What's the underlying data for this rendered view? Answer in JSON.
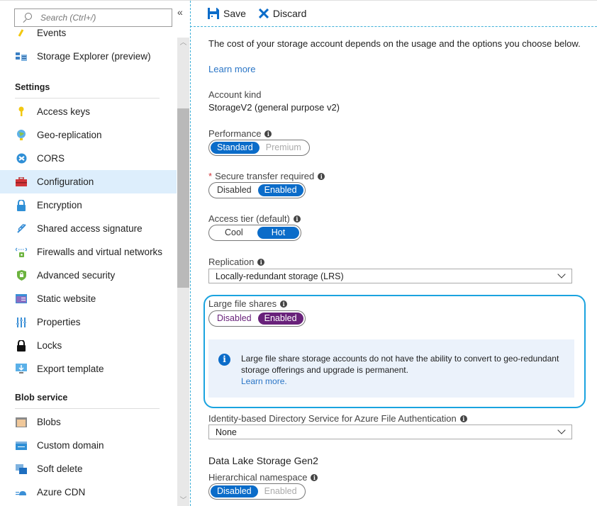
{
  "sidebar": {
    "search_placeholder": "Search (Ctrl+/)",
    "collapse_icon": "double-chevron-left",
    "items_top": [
      {
        "label": "Events",
        "icon": "lightning-icon"
      },
      {
        "label": "Storage Explorer (preview)",
        "icon": "storage-explorer-icon"
      }
    ],
    "settings_header": "Settings",
    "settings_items": [
      {
        "label": "Access keys",
        "icon": "key-icon"
      },
      {
        "label": "Geo-replication",
        "icon": "globe-icon"
      },
      {
        "label": "CORS",
        "icon": "cors-icon"
      },
      {
        "label": "Configuration",
        "icon": "toolbox-icon",
        "active": true
      },
      {
        "label": "Encryption",
        "icon": "lock-icon"
      },
      {
        "label": "Shared access signature",
        "icon": "link-icon"
      },
      {
        "label": "Firewalls and virtual networks",
        "icon": "firewall-icon"
      },
      {
        "label": "Advanced security",
        "icon": "shield-icon"
      },
      {
        "label": "Static website",
        "icon": "website-icon"
      },
      {
        "label": "Properties",
        "icon": "properties-icon"
      },
      {
        "label": "Locks",
        "icon": "padlock-icon"
      },
      {
        "label": "Export template",
        "icon": "export-icon"
      }
    ],
    "blob_header": "Blob service",
    "blob_items": [
      {
        "label": "Blobs",
        "icon": "blobs-icon"
      },
      {
        "label": "Custom domain",
        "icon": "www-icon"
      },
      {
        "label": "Soft delete",
        "icon": "soft-delete-icon"
      },
      {
        "label": "Azure CDN",
        "icon": "cdn-icon"
      }
    ]
  },
  "toolbar": {
    "save_label": "Save",
    "discard_label": "Discard"
  },
  "main": {
    "intro_text": "The cost of your storage account depends on the usage and the options you choose below.",
    "learn_more": "Learn more",
    "account_kind_label": "Account kind",
    "account_kind_value": "StorageV2 (general purpose v2)",
    "performance": {
      "label": "Performance",
      "options": [
        "Standard",
        "Premium"
      ],
      "selected": "Standard"
    },
    "secure_transfer": {
      "label": "Secure transfer required",
      "required_mark": "*",
      "options": [
        "Disabled",
        "Enabled"
      ],
      "selected": "Enabled"
    },
    "access_tier": {
      "label": "Access tier (default)",
      "options": [
        "Cool",
        "Hot"
      ],
      "selected": "Hot"
    },
    "replication": {
      "label": "Replication",
      "value": "Locally-redundant storage (LRS)"
    },
    "large_file_shares": {
      "label": "Large file shares",
      "options": [
        "Disabled",
        "Enabled"
      ],
      "selected": "Enabled"
    },
    "info_message": {
      "text": "Large file share storage accounts do not have the ability to convert to geo-redundant storage offerings and upgrade is permanent.",
      "link": "Learn more."
    },
    "identity_service": {
      "label": "Identity-based Directory Service for Azure File Authentication",
      "value": "None"
    },
    "data_lake_title": "Data Lake Storage Gen2",
    "hierarchical_namespace": {
      "label": "Hierarchical namespace",
      "options": [
        "Disabled",
        "Enabled"
      ],
      "selected": "Disabled"
    }
  },
  "colors": {
    "accent": "#0b6cc9",
    "purple_accent": "#68217a",
    "highlight_border": "#1aa3df",
    "active_nav": "#ddeefc",
    "link": "#2a75c6",
    "info_bg": "#ebf2fb"
  }
}
